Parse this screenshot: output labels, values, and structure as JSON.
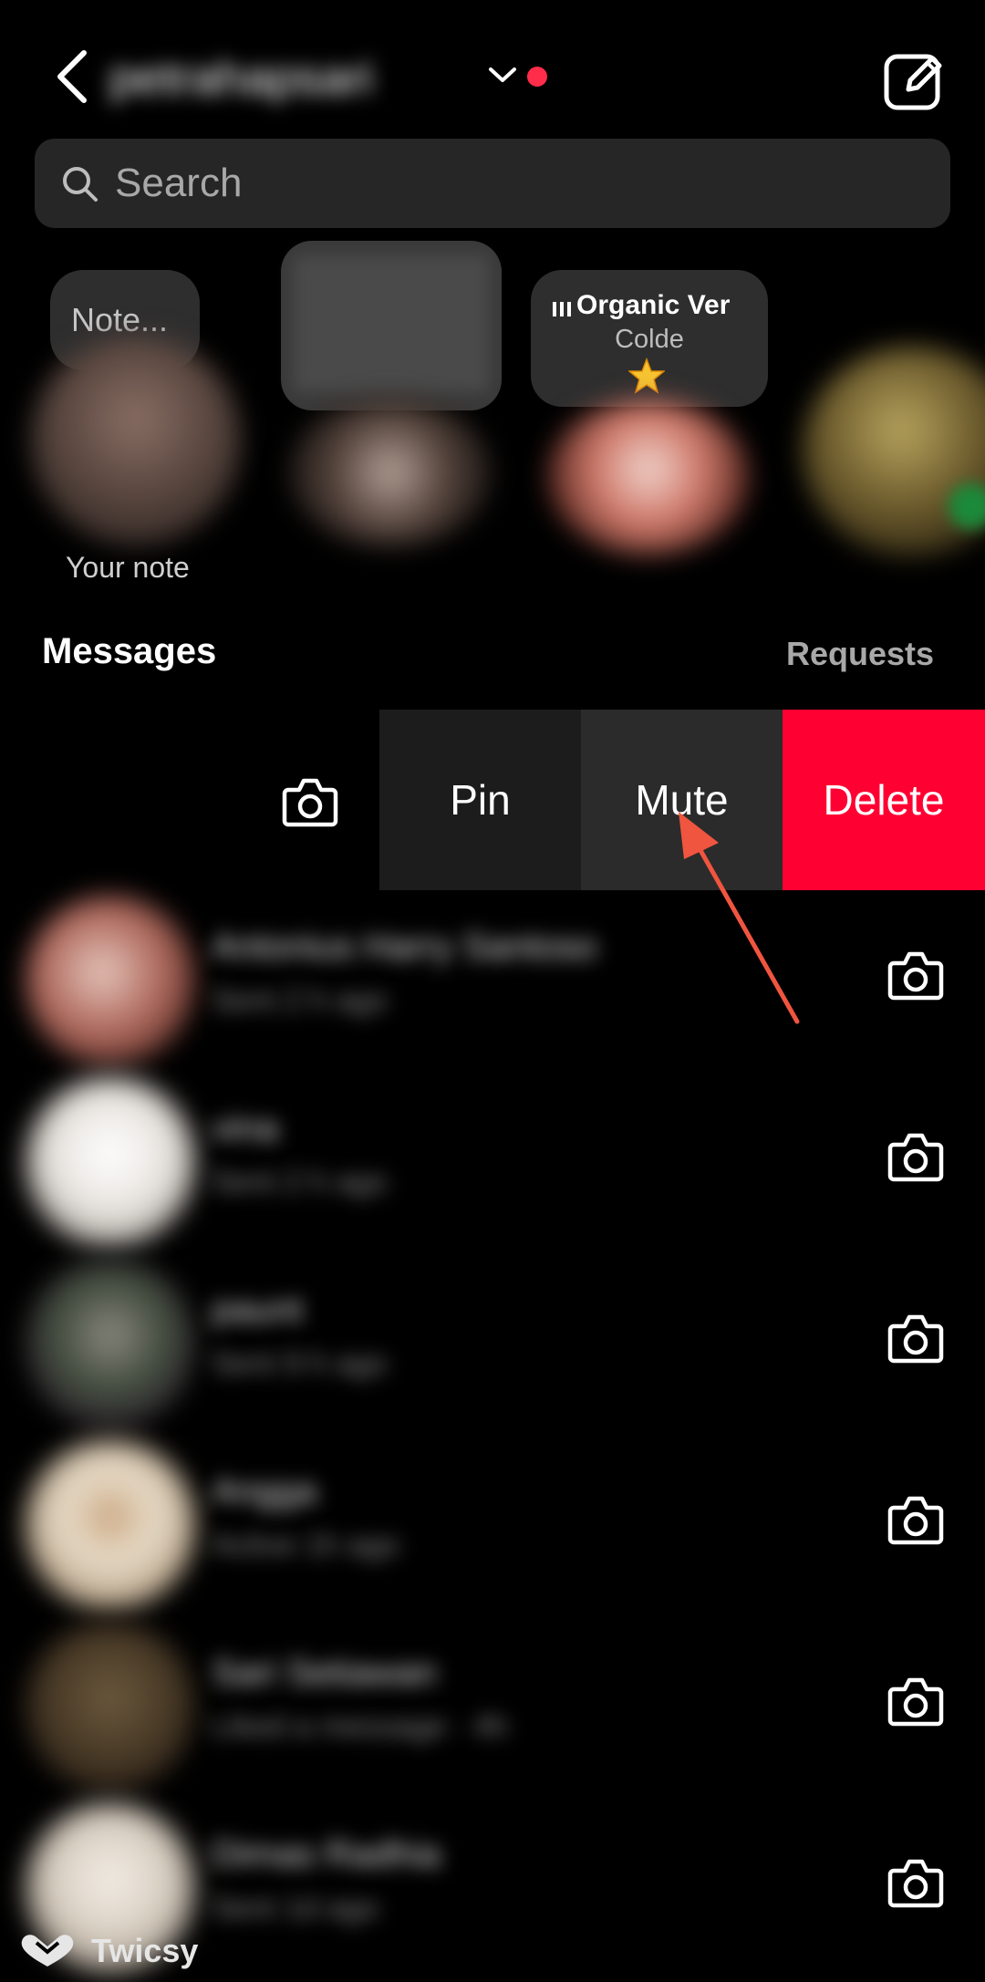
{
  "header": {
    "username": "petrahapsari",
    "unread_dot_color": "#ff2d4a"
  },
  "search": {
    "placeholder": "Search"
  },
  "notes": {
    "my_note_placeholder": "Note...",
    "my_label": "Your note",
    "music_note": {
      "song": "Organic Ver",
      "artist": "Colde",
      "emoji": "star"
    }
  },
  "sections": {
    "messages": "Messages",
    "requests": "Requests"
  },
  "swipe_actions": {
    "pin": "Pin",
    "mute": "Mute",
    "delete": "Delete",
    "delete_color": "#ff0033"
  },
  "annotation": {
    "arrow_color": "#f0553f",
    "target": "mute"
  },
  "conversations": [
    {
      "name": "Antonius Harry Santoso",
      "subtitle": "Sent 2 h ago"
    },
    {
      "name": "vina",
      "subtitle": "Sent 2 h ago"
    },
    {
      "name": "paunt",
      "subtitle": "Sent 9 h ago"
    },
    {
      "name": "Angga",
      "subtitle": "Active 1h ago"
    },
    {
      "name": "Sari Setiawan",
      "subtitle": "Liked a message · 4h"
    },
    {
      "name": "Dimas Radhia",
      "subtitle": "Sent 1d ago"
    }
  ],
  "watermark": "Twicsy"
}
